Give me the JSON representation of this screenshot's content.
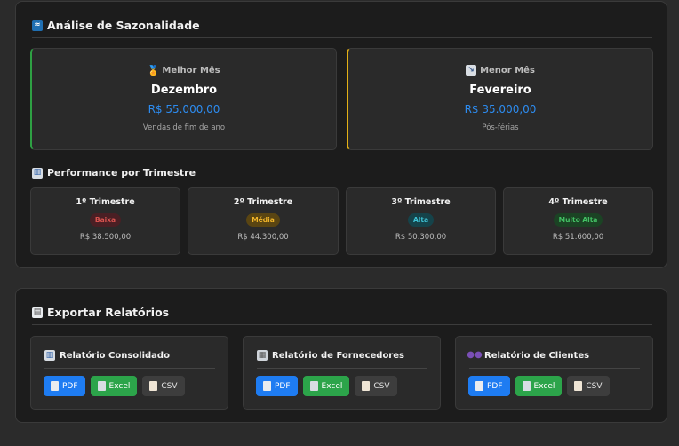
{
  "seasonality": {
    "title": "Análise de Sazonalidade",
    "best": {
      "label": "Melhor Mês",
      "month": "Dezembro",
      "amount": "R$ 55.000,00",
      "note": "Vendas de fim de ano",
      "accent": "#2ea043"
    },
    "worst": {
      "label": "Menor Mês",
      "month": "Fevereiro",
      "amount": "R$ 35.000,00",
      "note": "Pós-férias",
      "accent": "#e3b015"
    },
    "quarters_title": "Performance por Trimestre",
    "quarters": [
      {
        "name": "1º Trimestre",
        "level": "Baixa",
        "value": "R$ 38.500,00",
        "badge_bg": "#4a1f24",
        "badge_fg": "#d9534f"
      },
      {
        "name": "2º Trimestre",
        "level": "Média",
        "value": "R$ 44.300,00",
        "badge_bg": "#5a4512",
        "badge_fg": "#f0b429"
      },
      {
        "name": "3º Trimestre",
        "level": "Alta",
        "value": "R$ 50.300,00",
        "badge_bg": "#15434a",
        "badge_fg": "#3ec1d3"
      },
      {
        "name": "4º Trimestre",
        "level": "Muito Alta",
        "value": "R$ 51.600,00",
        "badge_bg": "#1b4324",
        "badge_fg": "#43c164"
      }
    ]
  },
  "export": {
    "title": "Exportar Relatórios",
    "reports": [
      {
        "title": "Relatório Consolidado",
        "icon": "chart-icon"
      },
      {
        "title": "Relatório de Fornecedores",
        "icon": "building-icon"
      },
      {
        "title": "Relatório de Clientes",
        "icon": "people-icon"
      }
    ],
    "buttons": {
      "pdf": "PDF",
      "excel": "Excel",
      "csv": "CSV"
    }
  },
  "colors": {
    "accent_blue": "#1e7cf2",
    "amount_blue": "#2d8cf0",
    "excel_green": "#2ca44a"
  }
}
